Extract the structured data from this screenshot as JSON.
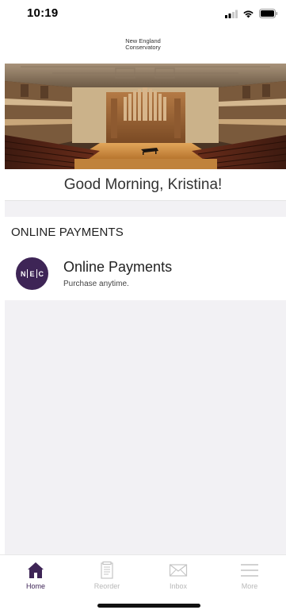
{
  "status_bar": {
    "time": "10:19"
  },
  "brand": {
    "line1": "New England",
    "line2": "Conservatory"
  },
  "greeting": "Good Morning, Kristina!",
  "section": {
    "title": "ONLINE PAYMENTS",
    "items": [
      {
        "logo_letters": [
          "N",
          "E",
          "C"
        ],
        "title": "Online Payments",
        "subtitle": "Purchase anytime."
      }
    ]
  },
  "tabs": [
    {
      "label": "Home",
      "icon": "home-icon",
      "active": true
    },
    {
      "label": "Reorder",
      "icon": "document-icon",
      "active": false
    },
    {
      "label": "Inbox",
      "icon": "envelope-icon",
      "active": false
    },
    {
      "label": "More",
      "icon": "menu-icon",
      "active": false
    }
  ],
  "colors": {
    "accent": "#3e2556",
    "inactive": "#b8b8b8",
    "background": "#f2f1f4"
  }
}
